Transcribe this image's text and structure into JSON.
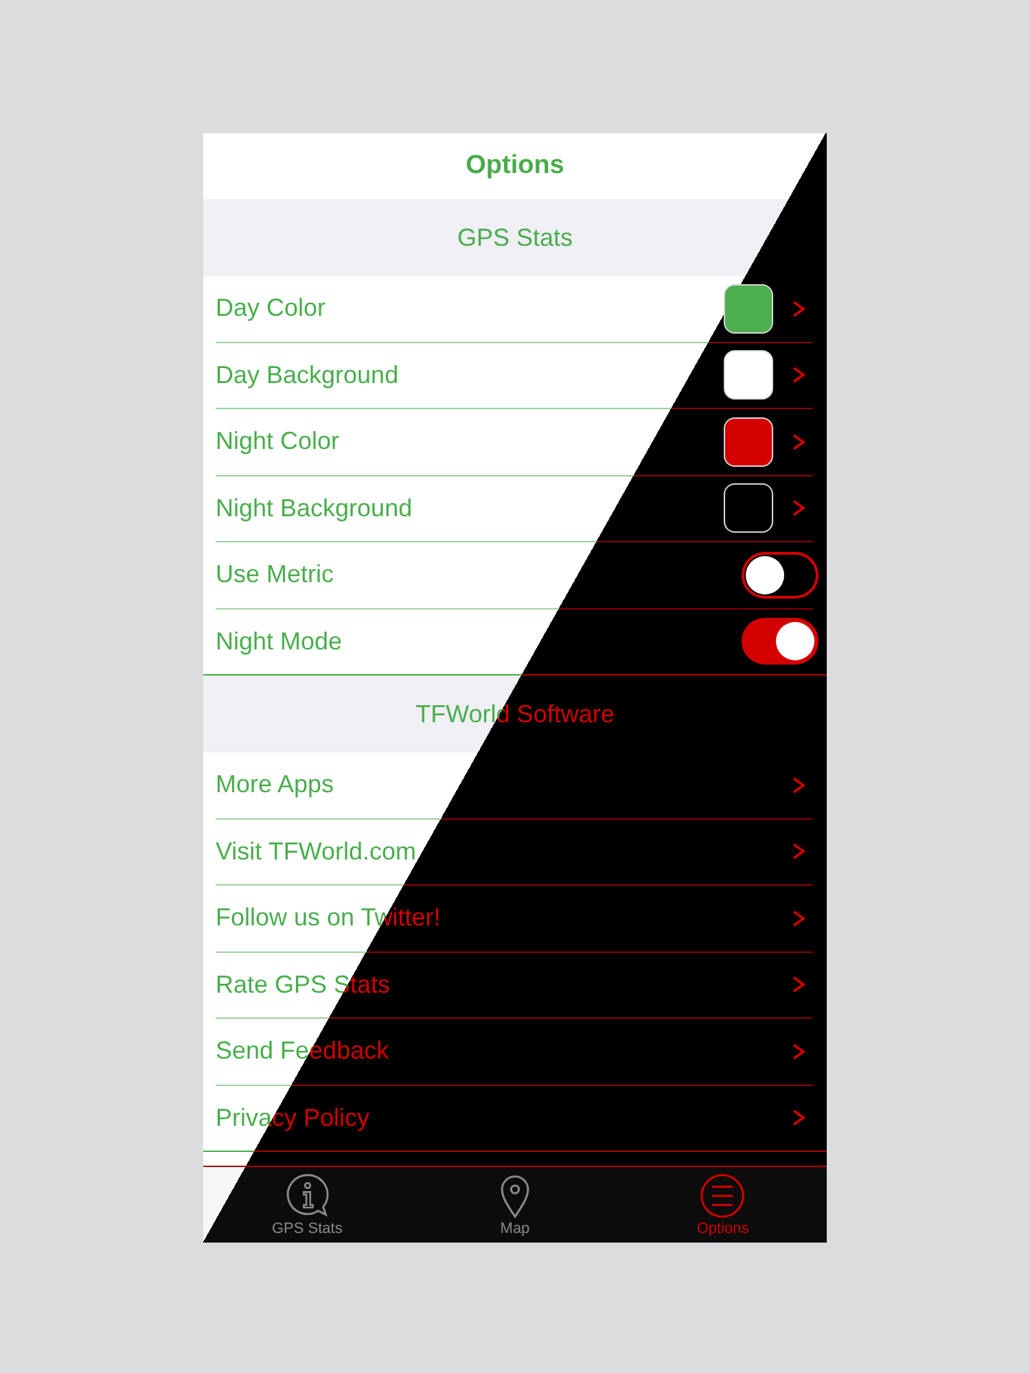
{
  "title": "Options",
  "sections": [
    {
      "header": "GPS Stats",
      "rows": [
        {
          "kind": "color",
          "label": "Day Color",
          "color": "#4caf50"
        },
        {
          "kind": "color",
          "label": "Day Background",
          "color": "#ffffff"
        },
        {
          "kind": "color",
          "label": "Night Color",
          "color": "#d40000"
        },
        {
          "kind": "color",
          "label": "Night Background",
          "color": "#000000"
        },
        {
          "kind": "toggle",
          "label": "Use Metric",
          "on": false
        },
        {
          "kind": "toggle",
          "label": "Night Mode",
          "on": true
        }
      ]
    },
    {
      "header": "TFWorld Software",
      "rows": [
        {
          "kind": "link",
          "label": "More Apps"
        },
        {
          "kind": "link",
          "label": "Visit TFWorld.com"
        },
        {
          "kind": "link",
          "label": "Follow us on Twitter!"
        },
        {
          "kind": "link",
          "label": "Rate GPS Stats"
        },
        {
          "kind": "link",
          "label": "Send Feedback"
        },
        {
          "kind": "link",
          "label": "Privacy Policy"
        }
      ]
    }
  ],
  "tabs": [
    {
      "kind": "info",
      "label": "GPS Stats",
      "selected": false
    },
    {
      "kind": "pin",
      "label": "Map",
      "selected": false
    },
    {
      "kind": "menu",
      "label": "Options",
      "selected": true
    }
  ]
}
